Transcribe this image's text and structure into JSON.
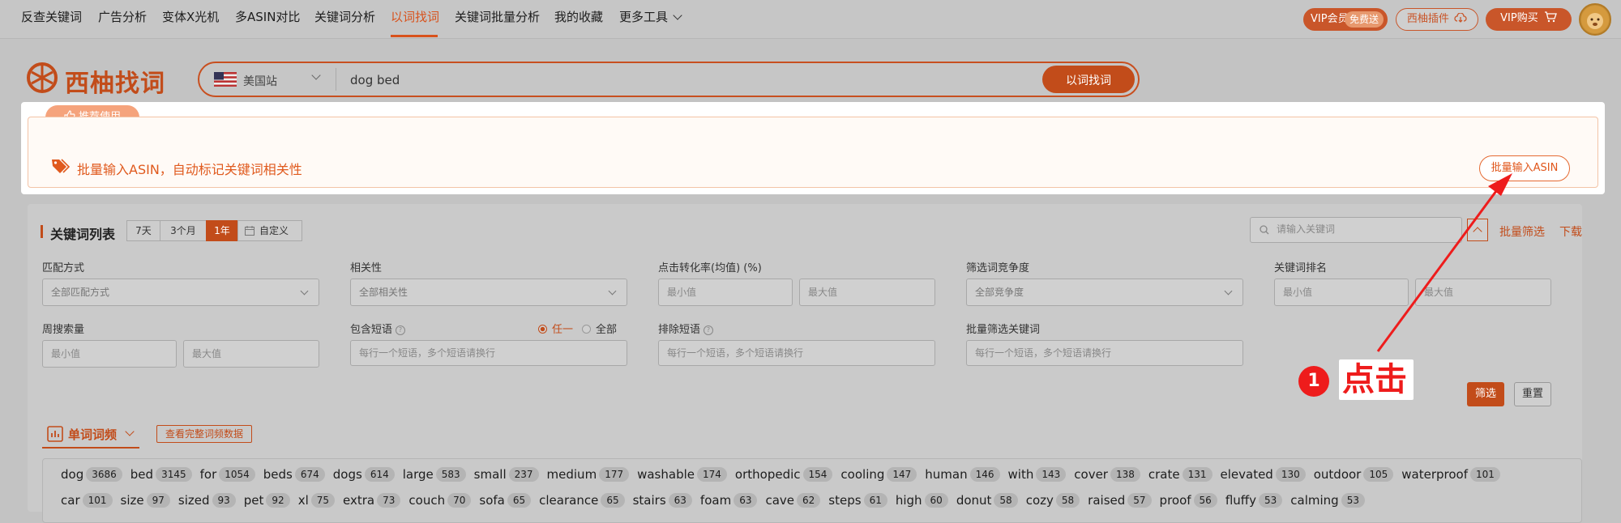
{
  "nav": {
    "items": [
      {
        "label": "反查关键词",
        "active": false
      },
      {
        "label": "广告分析",
        "active": false
      },
      {
        "label": "变体X光机",
        "active": false
      },
      {
        "label": "多ASIN对比",
        "active": false
      },
      {
        "label": "关键词分析",
        "active": false
      },
      {
        "label": "以词找词",
        "active": true
      },
      {
        "label": "关键词批量分析",
        "active": false
      },
      {
        "label": "我的收藏",
        "active": false
      },
      {
        "label": "更多工具",
        "active": false
      }
    ],
    "vip_label": "VIP会员",
    "vip_free": "免费送",
    "plugin_label": "西柚插件",
    "buy_label": "VIP购买"
  },
  "search": {
    "logo_text": "西柚找词",
    "site": "美国站",
    "query": "dog bed",
    "button": "以词找词"
  },
  "highlight": {
    "badge": "推荐使用",
    "text": "批量输入ASIN，自动标记关键词相关性",
    "button": "批量输入ASIN"
  },
  "panel": {
    "title": "关键词列表",
    "ranges": [
      "7天",
      "3个月",
      "1年",
      "自定义"
    ],
    "active_range": "1年",
    "kw_search_placeholder": "请输入关键词",
    "batch_filter": "批量筛选",
    "download": "下载"
  },
  "filters": {
    "match_label": "匹配方式",
    "match_value": "全部匹配方式",
    "relevance_label": "相关性",
    "relevance_value": "全部相关性",
    "ctr_label": "点击转化率(均值) (%)",
    "min_ph": "最小值",
    "max_ph": "最大值",
    "competition_label": "筛选词竞争度",
    "competition_value": "全部竞争度",
    "rank_label": "关键词排名",
    "weekly_label": "周搜索量",
    "include_label": "包含短语",
    "any_label": "任一",
    "all_label": "全部",
    "phrase_ph": "每行一个短语，多个短语请换行",
    "exclude_label": "排除短语",
    "batch_kw_label": "批量筛选关键词",
    "filter_btn": "筛选",
    "reset_btn": "重置"
  },
  "freq": {
    "tab_label": "单词词频",
    "full_btn": "查看完整词频数据",
    "row1": [
      {
        "w": "dog",
        "c": "3686"
      },
      {
        "w": "bed",
        "c": "3145"
      },
      {
        "w": "for",
        "c": "1054"
      },
      {
        "w": "beds",
        "c": "674"
      },
      {
        "w": "dogs",
        "c": "614"
      },
      {
        "w": "large",
        "c": "583"
      },
      {
        "w": "small",
        "c": "237"
      },
      {
        "w": "medium",
        "c": "177"
      },
      {
        "w": "washable",
        "c": "174"
      },
      {
        "w": "orthopedic",
        "c": "154"
      },
      {
        "w": "cooling",
        "c": "147"
      },
      {
        "w": "human",
        "c": "146"
      },
      {
        "w": "with",
        "c": "143"
      },
      {
        "w": "cover",
        "c": "138"
      },
      {
        "w": "crate",
        "c": "131"
      },
      {
        "w": "elevated",
        "c": "130"
      },
      {
        "w": "outdoor",
        "c": "105"
      },
      {
        "w": "waterproof",
        "c": "101"
      }
    ],
    "row2": [
      {
        "w": "car",
        "c": "101"
      },
      {
        "w": "size",
        "c": "97"
      },
      {
        "w": "sized",
        "c": "93"
      },
      {
        "w": "pet",
        "c": "92"
      },
      {
        "w": "xl",
        "c": "75"
      },
      {
        "w": "extra",
        "c": "73"
      },
      {
        "w": "couch",
        "c": "70"
      },
      {
        "w": "sofa",
        "c": "65"
      },
      {
        "w": "clearance",
        "c": "65"
      },
      {
        "w": "stairs",
        "c": "63"
      },
      {
        "w": "foam",
        "c": "63"
      },
      {
        "w": "cave",
        "c": "62"
      },
      {
        "w": "steps",
        "c": "61"
      },
      {
        "w": "high",
        "c": "60"
      },
      {
        "w": "donut",
        "c": "58"
      },
      {
        "w": "cozy",
        "c": "58"
      },
      {
        "w": "raised",
        "c": "57"
      },
      {
        "w": "proof",
        "c": "56"
      },
      {
        "w": "fluffy",
        "c": "53"
      },
      {
        "w": "calming",
        "c": "53"
      }
    ]
  },
  "annotation": {
    "step": "1",
    "text": "点击"
  },
  "colors": {
    "accent": "#c24c1a",
    "annotation_red": "#ee1c1c"
  }
}
